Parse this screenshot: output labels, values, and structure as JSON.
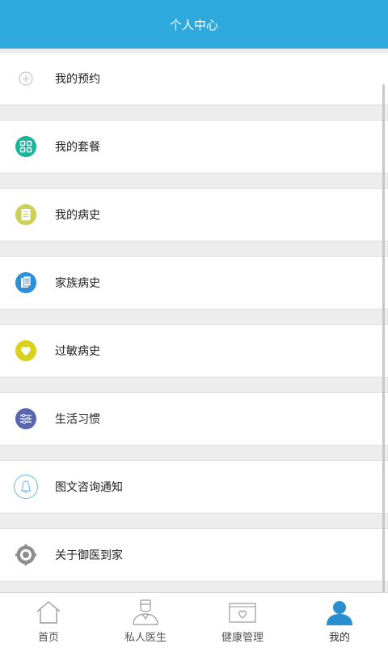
{
  "header": {
    "title": "个人中心"
  },
  "menu": [
    {
      "label": "我的预约",
      "icon": "plus-circle-icon",
      "color": "#c8c8c8"
    },
    {
      "label": "我的套餐",
      "icon": "grid-icon",
      "color": "#1bb39a"
    },
    {
      "label": "我的病史",
      "icon": "notepad-icon",
      "color": "#cdd05a"
    },
    {
      "label": "家族病史",
      "icon": "document-icon",
      "color": "#2f8fd6"
    },
    {
      "label": "过敏病史",
      "icon": "heart-icon",
      "color": "#d9d11e"
    },
    {
      "label": "生活习惯",
      "icon": "sliders-icon",
      "color": "#5866b0"
    },
    {
      "label": "图文咨询通知",
      "icon": "bell-icon",
      "color": "#7cc1e6"
    },
    {
      "label": "关于御医到家",
      "icon": "gear-icon",
      "color": "#8e8e8e"
    }
  ],
  "tabs": [
    {
      "label": "首页",
      "icon": "home-icon"
    },
    {
      "label": "私人医生",
      "icon": "doctor-icon"
    },
    {
      "label": "健康管理",
      "icon": "health-folder-icon"
    },
    {
      "label": "我的",
      "icon": "user-icon",
      "active": true
    }
  ],
  "colors": {
    "accent": "#2ea9de",
    "active_tab": "#2a8fcf"
  }
}
